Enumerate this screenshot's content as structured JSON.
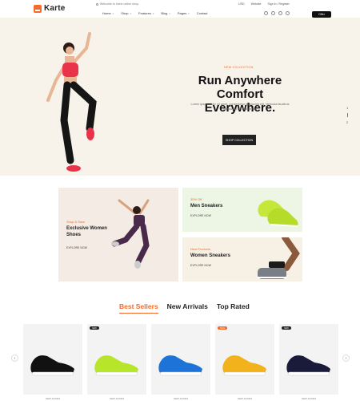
{
  "brand": {
    "name": "Karte"
  },
  "topbar": {
    "welcome": "Welcome to Karte online shop.",
    "currency": "USD",
    "language": "Website",
    "account": "Sign in / Register"
  },
  "nav": {
    "items": [
      "Home",
      "Shop",
      "Features",
      "Blog",
      "Pages",
      "Contact"
    ]
  },
  "header": {
    "offer_label": "Offer"
  },
  "hero": {
    "kicker": "NEW COLLECTION",
    "title": "Run Anywhere Comfort Everywhere.",
    "description": "Lorem ipsum dolor sit amet, consectetur adipiscing elit. Vehicula faucibus massa est elit maecenas.",
    "button_label": "SHOP COLLECTION",
    "slide_current": "1",
    "slide_next": "2"
  },
  "banners": [
    {
      "kicker": "Shop & Save",
      "title": "Exclusive Women Shoes",
      "link": "EXPLORE NOW"
    },
    {
      "kicker": "30% Off",
      "title": "Men Sneakers",
      "link": "EXPLORE NOW"
    },
    {
      "kicker": "New Products",
      "title": "Women Sneakers",
      "link": "EXPLORE NOW"
    }
  ],
  "tabs": [
    "Best Sellers",
    "New Arrivals",
    "Top Rated"
  ],
  "products": [
    {
      "badge": "",
      "label": "NEW SHOES",
      "color": "#111111"
    },
    {
      "badge": "NEW",
      "label": "NEW SHOES",
      "color": "#b6e52a"
    },
    {
      "badge": "",
      "label": "NEW SHOES",
      "color": "#1e73d8"
    },
    {
      "badge": "SALE",
      "label": "NEW SHOES",
      "color": "#f2b21b"
    },
    {
      "badge": "NEW",
      "label": "NEW SHOES",
      "color": "#1a1a3a"
    }
  ],
  "colors": {
    "accent": "#f26b2a",
    "hero_bg": "#f7f2ea"
  }
}
